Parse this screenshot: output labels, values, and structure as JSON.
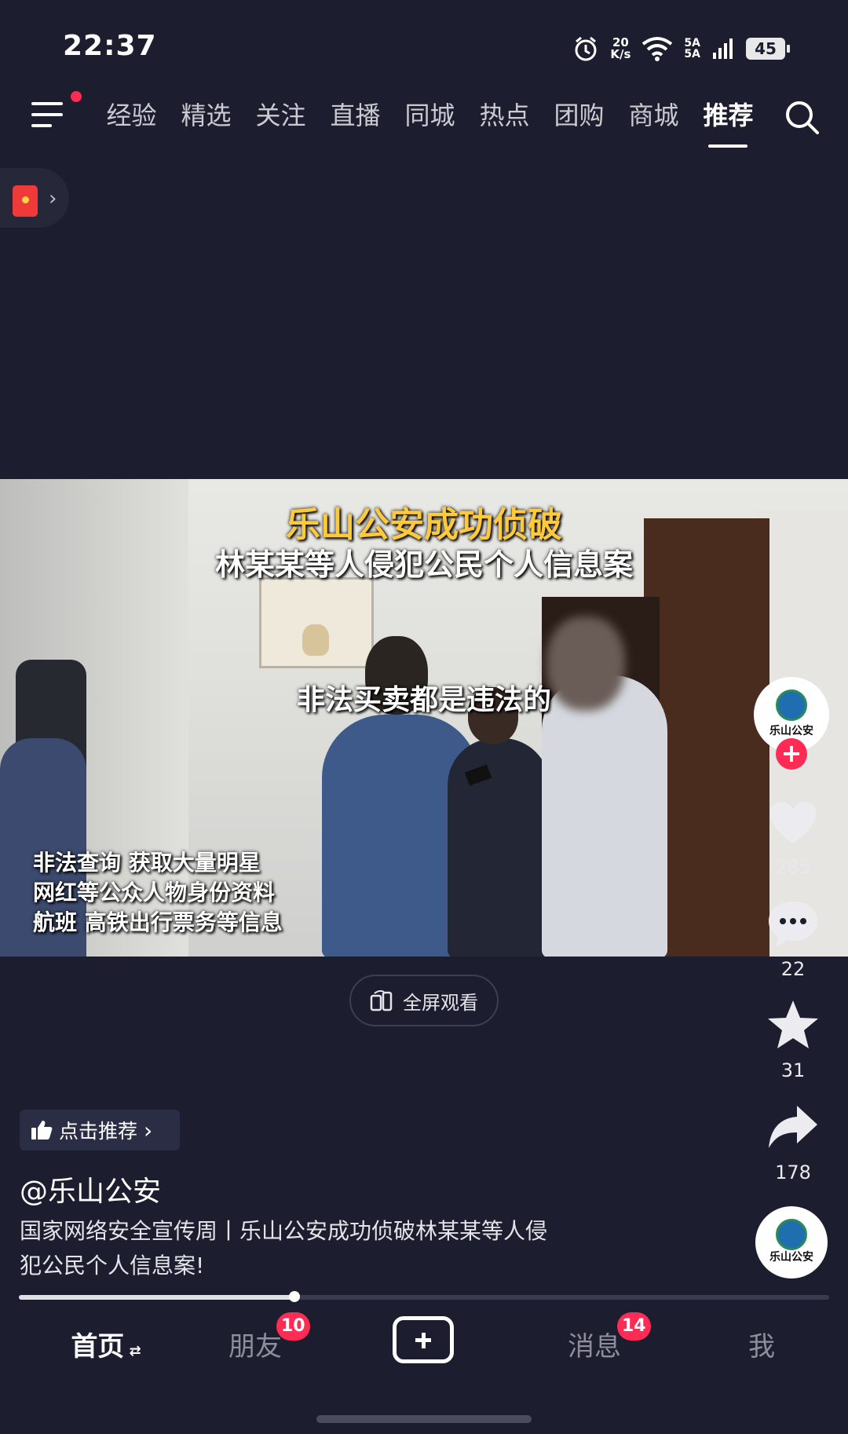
{
  "status_bar": {
    "time": "22:37",
    "net_speed_top": "20",
    "net_speed_bottom": "K/s",
    "sim1": "5A",
    "sim2": "5A",
    "battery": "45"
  },
  "top_tabs": [
    "经验",
    "精选",
    "关注",
    "直播",
    "同城",
    "热点",
    "团购",
    "商城",
    "推荐"
  ],
  "active_tab": "推荐",
  "video": {
    "caption_title": "乐山公安成功侦破",
    "caption_subtitle": "林某某等人侵犯公民个人信息案",
    "caption_mid": "非法买卖都是违法的",
    "caption_bottom": [
      "非法查询 获取大量明星",
      "网红等公众人物身份资料",
      "航班 高铁出行票务等信息"
    ]
  },
  "fullscreen_label": "全屏观看",
  "right_rail": {
    "avatar_text": "乐山公安",
    "likes": "285",
    "comments": "22",
    "favorites": "31",
    "shares": "178"
  },
  "recommend_label": "点击推荐",
  "author": "@乐山公安",
  "description_lines": [
    "国家网络安全宣传周丨乐山公安成功侦破林某某等人侵",
    "犯公民个人信息案!"
  ],
  "progress": 0.34,
  "bottom_nav": {
    "home": "首页",
    "friends": "朋友",
    "friends_badge": "10",
    "messages": "消息",
    "messages_badge": "14",
    "me": "我"
  },
  "colors": {
    "accent": "#fe2c55",
    "background": "#1c1d2e",
    "caption_gold": "#ffc93c"
  }
}
